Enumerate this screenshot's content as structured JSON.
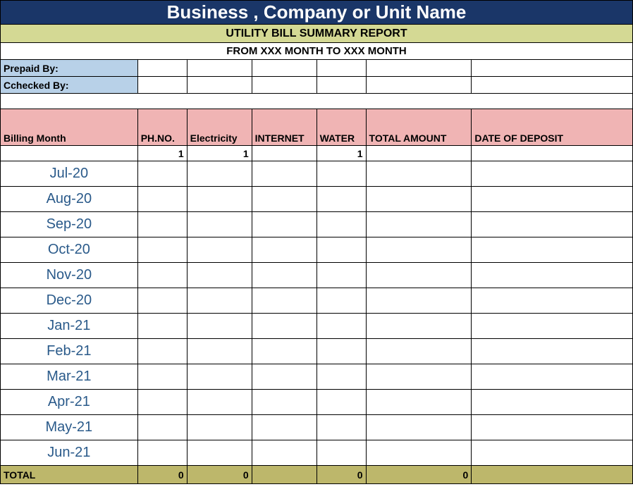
{
  "title": "Business , Company or Unit Name",
  "subtitle": "UTILITY BILL SUMMARY REPORT",
  "period": "FROM XXX MONTH  TO XXX MONTH",
  "meta": {
    "prepaid_label": "Prepaid By:",
    "checked_label": "Cchecked By:"
  },
  "headers": {
    "billing_month": "Billing Month",
    "phno": "PH.NO.",
    "electricity": "Electricity",
    "internet": "INTERNET",
    "water": "WATER",
    "total_amount": "TOTAL AMOUNT",
    "date_deposit": "DATE OF DEPOSIT"
  },
  "num_row": {
    "phno": "1",
    "electricity": "1",
    "internet": "",
    "water": "1",
    "total_amount": "",
    "date_deposit": ""
  },
  "months": [
    "Jul-20",
    "Aug-20",
    "Sep-20",
    "Oct-20",
    "Nov-20",
    "Dec-20",
    "Jan-21",
    "Feb-21",
    "Mar-21",
    "Apr-21",
    "May-21",
    "Jun-21"
  ],
  "totals": {
    "label": "TOTAL",
    "phno": "0",
    "electricity": "0",
    "internet": "",
    "water": "0",
    "total_amount": "0",
    "date_deposit": ""
  }
}
